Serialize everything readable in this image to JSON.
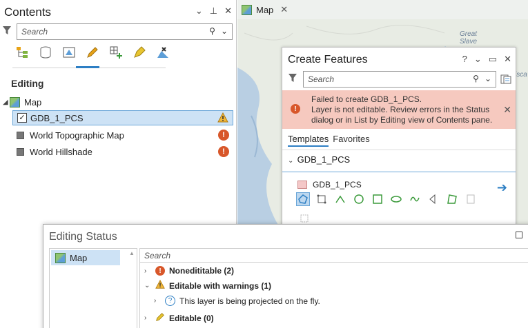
{
  "contents": {
    "title": "Contents",
    "search_placeholder": "Search",
    "heading": "Editing",
    "map_label": "Map",
    "layers": [
      {
        "name": "GDB_1_PCS",
        "status": "warning"
      },
      {
        "name": "World Topographic Map",
        "status": "error"
      },
      {
        "name": "World Hillshade",
        "status": "error"
      }
    ]
  },
  "map_tab": {
    "label": "Map",
    "close": "✕"
  },
  "map_labels": {
    "great_slave": "Great\nSlave",
    "edge": "isca"
  },
  "create_features": {
    "title": "Create Features",
    "help": "?",
    "search_placeholder": "Search",
    "error_message": "Failed to create GDB_1_PCS.\nLayer is not editable. Review errors in the Status dialog or in List by Editing view of Contents pane.",
    "tabs": [
      "Templates",
      "Favorites"
    ],
    "group": "GDB_1_PCS",
    "template_name": "GDB_1_PCS"
  },
  "editing_status": {
    "title": "Editing Status",
    "map_item": "Map",
    "search_placeholder": "Search",
    "rows": [
      {
        "label": "Nonedititable (2)"
      },
      {
        "label": "Editable with warnings (1)"
      },
      {
        "label": "This layer is being projected on the fly."
      },
      {
        "label": "Editable (0)"
      }
    ]
  },
  "colors": {
    "accent": "#2d7fc4",
    "error": "#d8572a",
    "warning": "#e8a317",
    "banner": "#f6c9bf"
  }
}
